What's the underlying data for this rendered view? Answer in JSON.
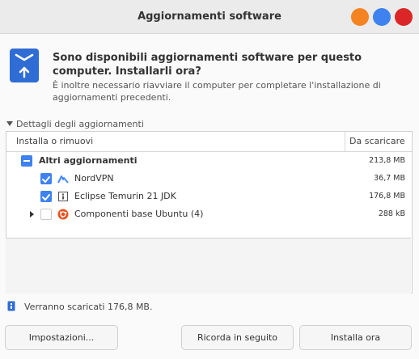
{
  "window": {
    "title": "Aggiornamenti software",
    "controls": {
      "minimize_color": "#f48322",
      "maximize_color": "#3d82ef",
      "close_color": "#da2626"
    }
  },
  "header": {
    "icon": "software-updater-icon",
    "heading": "Sono disponibili aggiornamenti software per questo computer. Installarli ora?",
    "subtext": "È inoltre necessario riavviare il computer per completare l'installazione di aggiornamenti precedenti."
  },
  "details": {
    "toggle_label": "Dettagli degli aggiornamenti",
    "expanded": true
  },
  "table": {
    "columns": [
      "Installa o rimuovi",
      "Da scaricare"
    ],
    "group": {
      "label": "Altri aggiornamenti",
      "size": "213,8 MB",
      "state": "mixed"
    },
    "rows": [
      {
        "label": "NordVPN",
        "size": "36,7 MB",
        "checked": true,
        "icon": "nordvpn-icon"
      },
      {
        "label": "Eclipse Temurin 21 JDK",
        "size": "176,8 MB",
        "checked": true,
        "icon": "package-icon"
      },
      {
        "label": "Componenti base Ubuntu (4)",
        "size": "288 kB",
        "checked": false,
        "icon": "ubuntu-icon",
        "expandable": true
      }
    ]
  },
  "status": {
    "icon": "download-info-icon",
    "text": "Verranno scaricati 176,8 MB."
  },
  "buttons": {
    "settings": "Impostazioni...",
    "remind_later": "Ricorda in seguito",
    "install_now": "Installa ora"
  },
  "colors": {
    "accent": "#3d82ef",
    "header_icon_bg": "#2f6dd5"
  }
}
